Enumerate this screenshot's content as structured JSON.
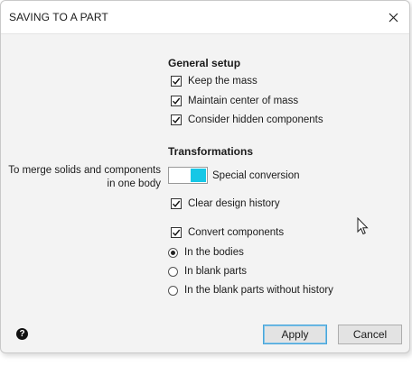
{
  "window": {
    "title": "SAVING TO A PART",
    "close_icon": "close-icon"
  },
  "general_setup": {
    "heading": "General setup",
    "options": [
      {
        "label": "Keep the mass",
        "checked": true
      },
      {
        "label": "Maintain center of mass",
        "checked": true
      },
      {
        "label": "Consider hidden components",
        "checked": true
      }
    ]
  },
  "transformations": {
    "heading": "Transformations",
    "merge_label_line1": "To merge solids and components",
    "merge_label_line2": "in one body",
    "toggle_label": "Special conversion",
    "toggle_on": true,
    "toggle_color": "#16c7e6",
    "clear_history": {
      "label": "Clear design history",
      "checked": true
    },
    "convert_components": {
      "label": "Convert components",
      "checked": true
    },
    "radio_options": [
      {
        "label": "In the bodies",
        "selected": true
      },
      {
        "label": "In blank parts",
        "selected": false
      },
      {
        "label": "In the blank parts without history",
        "selected": false
      }
    ]
  },
  "footer": {
    "help_icon": "help-icon",
    "apply_label": "Apply",
    "cancel_label": "Cancel"
  }
}
